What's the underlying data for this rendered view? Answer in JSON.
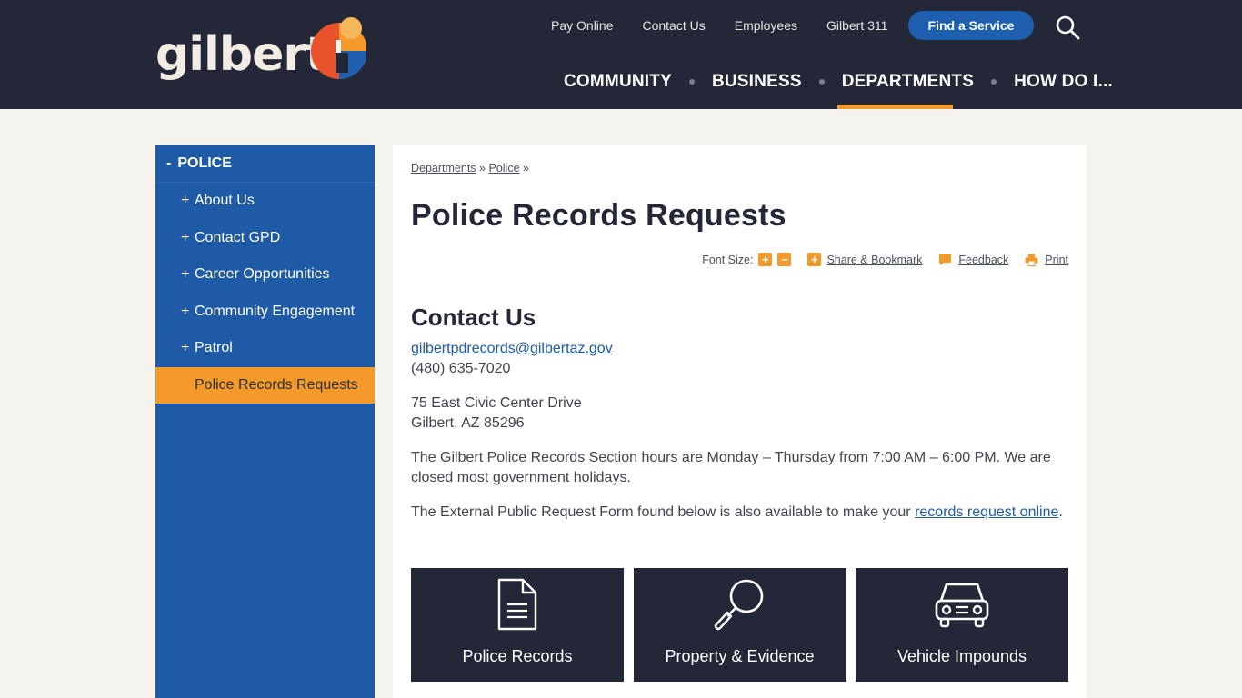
{
  "brand": {
    "logo_text": "gilbert"
  },
  "utility_nav": [
    "Pay Online",
    "Contact Us",
    "Employees",
    "Gilbert 311"
  ],
  "find_service_label": "Find a Service",
  "main_nav": [
    "COMMUNITY",
    "BUSINESS",
    "DEPARTMENTS",
    "HOW DO I..."
  ],
  "main_nav_active": "DEPARTMENTS",
  "sidebar": {
    "heading": "POLICE",
    "items": [
      {
        "label": "About Us",
        "marker": "+"
      },
      {
        "label": "Contact GPD",
        "marker": "+"
      },
      {
        "label": "Career Opportunities",
        "marker": "+"
      },
      {
        "label": "Community Engagement",
        "marker": "+"
      },
      {
        "label": "Patrol",
        "marker": "+"
      },
      {
        "label": "Police Records Requests",
        "marker": "",
        "active": true
      }
    ]
  },
  "breadcrumb": {
    "items": [
      "Departments",
      "Police"
    ],
    "separator": "»"
  },
  "page_title": "Police Records Requests",
  "tools": {
    "font_size_label": "Font Size:",
    "share_label": "Share & Bookmark",
    "feedback_label": "Feedback",
    "print_label": "Print"
  },
  "contact": {
    "heading": "Contact Us",
    "email": "gilbertpdrecords@gilbertaz.gov",
    "phone": "(480) 635-7020",
    "address_line1": "75 East Civic Center Drive",
    "address_line2": "Gilbert, AZ 85296",
    "hours_text": "The Gilbert Police Records Section hours are Monday – Thursday from 7:00 AM – 6:00 PM. We are closed most government holidays.",
    "form_text_before": "The External Public Request Form found below is also available to make your ",
    "form_link": "records request online",
    "form_text_after": "."
  },
  "tiles": [
    {
      "label": "Police Records",
      "icon": "document-icon"
    },
    {
      "label": "Property & Evidence",
      "icon": "magnifier-icon"
    },
    {
      "label": "Vehicle Impounds",
      "icon": "car-icon"
    }
  ],
  "colors": {
    "header_bg": "#232737",
    "accent_orange": "#f39a2b",
    "sidebar_blue": "#1f5aa6",
    "button_blue": "#1f5fb0",
    "page_bg": "#f5f3ee"
  }
}
